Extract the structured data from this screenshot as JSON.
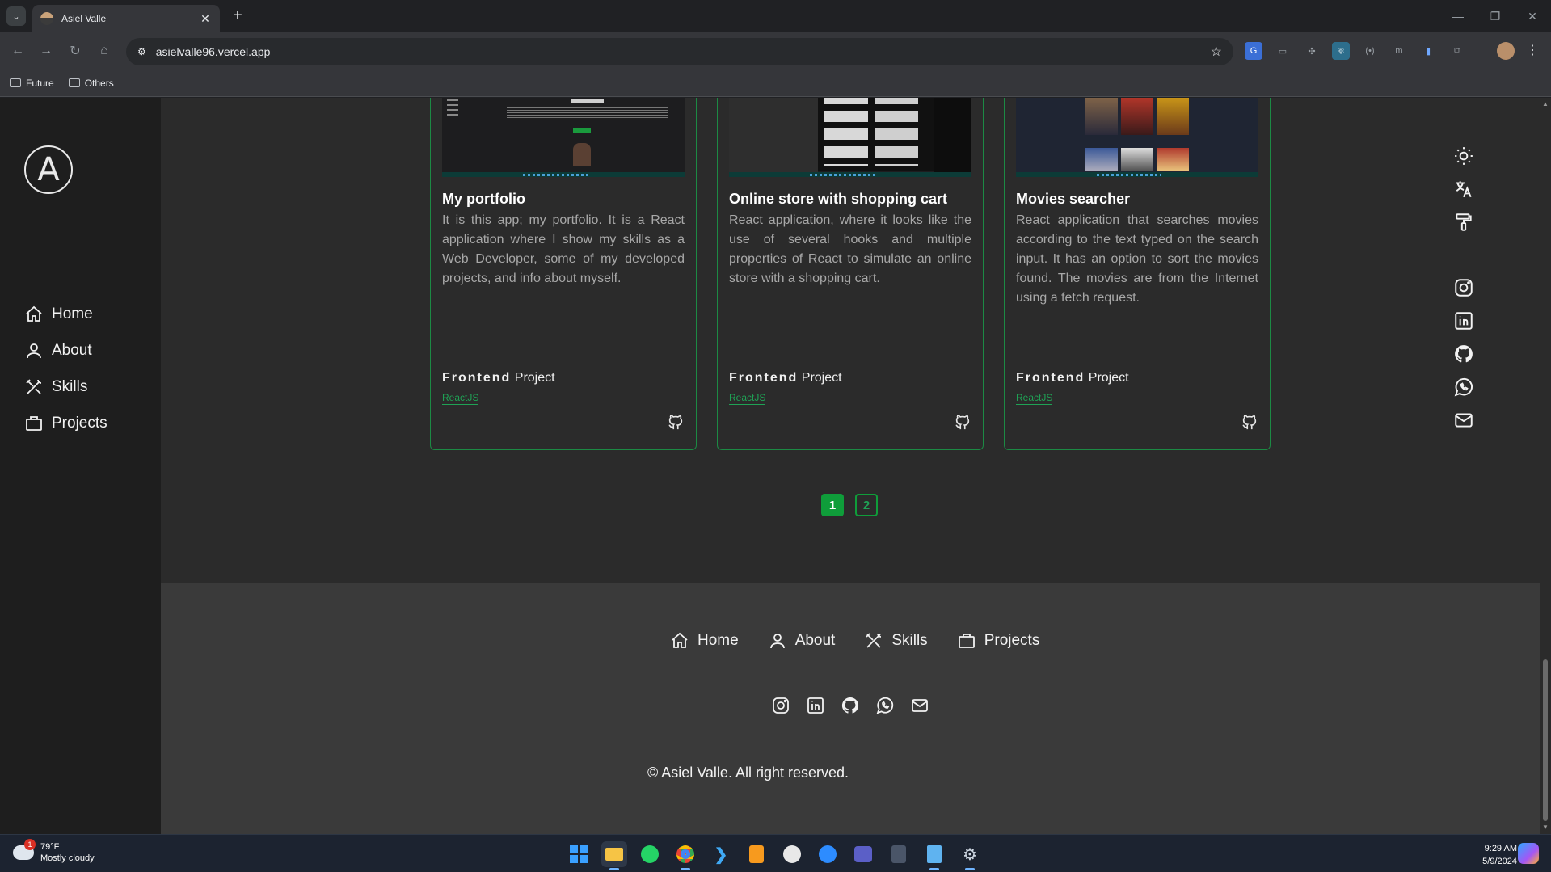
{
  "browser": {
    "tab_title": "Asiel Valle",
    "url": "asielvalle96.vercel.app",
    "bookmarks": [
      "Future",
      "Others"
    ]
  },
  "sidebar": {
    "logo_letter": "A",
    "items": [
      {
        "label": "Home",
        "icon": "home-icon"
      },
      {
        "label": "About",
        "icon": "user-icon"
      },
      {
        "label": "Skills",
        "icon": "tools-icon"
      },
      {
        "label": "Projects",
        "icon": "briefcase-icon"
      }
    ]
  },
  "projects": [
    {
      "title": "My portfolio",
      "description": "It is this app; my portfolio. It is a React application where I show my skills as a Web Developer, some of my developed projects, and info about myself.",
      "type_bold": "Frontend",
      "type_rest": " Project",
      "tag": "ReactJS"
    },
    {
      "title": "Online store with shopping cart",
      "description": "React application, where it looks like the use of several hooks and multiple properties of React to simulate an online store with a shopping cart.",
      "type_bold": "Frontend",
      "type_rest": " Project",
      "tag": "ReactJS"
    },
    {
      "title": "Movies searcher",
      "description": "React application that searches movies according to the text typed on the search input. It has an option to sort the movies found. The movies are from the Internet using a fetch request.",
      "type_bold": "Frontend",
      "type_rest": " Project",
      "tag": "ReactJS"
    }
  ],
  "pagination": {
    "pages": [
      "1",
      "2"
    ],
    "current": "1"
  },
  "footer": {
    "nav": [
      "Home",
      "About",
      "Skills",
      "Projects"
    ],
    "social": [
      "instagram-icon",
      "linkedin-icon",
      "github-icon",
      "whatsapp-icon",
      "mail-icon"
    ],
    "copyright": "© Asiel Valle. All right reserved."
  },
  "right_rail": {
    "tools": [
      "sun-icon",
      "translate-icon",
      "paint-roller-icon"
    ],
    "social": [
      "instagram-icon",
      "linkedin-icon",
      "github-icon",
      "whatsapp-icon",
      "mail-icon"
    ]
  },
  "taskbar": {
    "weather_temp": "79°F",
    "weather_desc": "Mostly cloudy",
    "weather_badge": "1",
    "time": "9:29 AM",
    "date": "5/9/2024"
  },
  "colors": {
    "accent": "#0f9d3a",
    "sidebar": "#1e1e1e",
    "page": "#2b2b2b",
    "footer": "#3a3a3a"
  }
}
